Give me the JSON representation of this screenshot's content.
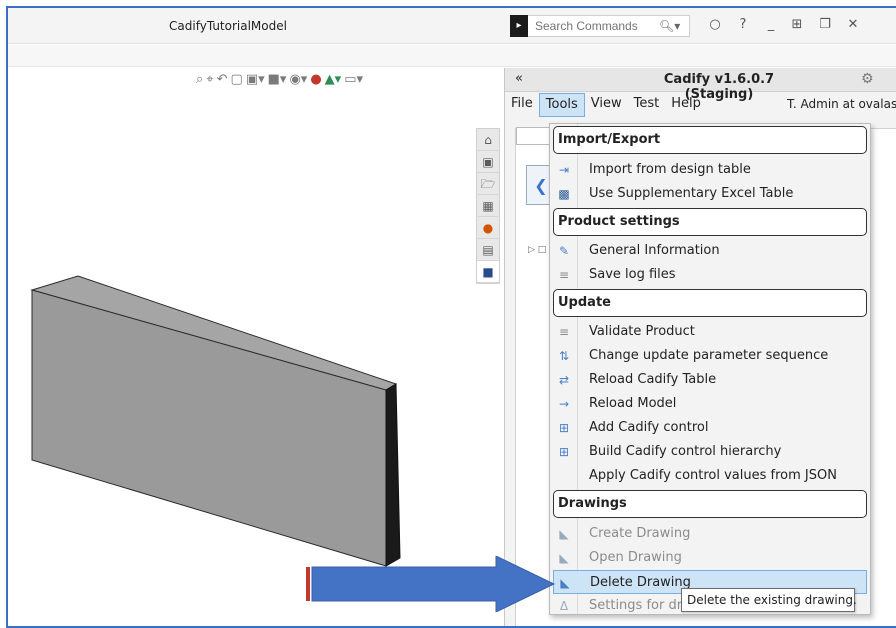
{
  "window": {
    "title": "CadifyTutorialModel",
    "search_placeholder": "Search Commands"
  },
  "panel": {
    "collapse_label": "«",
    "title": "Cadify v1.6.0.7 (Staging)",
    "user": "T. Admin at ovalas.ne",
    "menu": [
      "File",
      "Tools",
      "View",
      "Test",
      "Help"
    ]
  },
  "dropdown": {
    "sections": [
      {
        "title": "Import/Export",
        "items": [
          {
            "label": "Import from design table",
            "icon": "import-table-icon",
            "enabled": true
          },
          {
            "label": "Use Supplementary Excel Table",
            "icon": "excel-icon",
            "enabled": true
          }
        ]
      },
      {
        "title": "Product settings",
        "items": [
          {
            "label": "General Information",
            "icon": "info-edit-icon",
            "enabled": true
          },
          {
            "label": "Save log files",
            "icon": "checklist-icon",
            "enabled": true
          }
        ]
      },
      {
        "title": "Update",
        "items": [
          {
            "label": "Validate Product",
            "icon": "checklist-icon",
            "enabled": true
          },
          {
            "label": "Change update parameter sequence",
            "icon": "sort-icon",
            "enabled": true
          },
          {
            "label": "Reload Cadify Table",
            "icon": "reload-table-icon",
            "enabled": true
          },
          {
            "label": "Reload Model",
            "icon": "reload-model-icon",
            "enabled": true
          },
          {
            "label": "Add Cadify control",
            "icon": "add-control-icon",
            "enabled": true
          },
          {
            "label": "Build Cadify control hierarchy",
            "icon": "hierarchy-icon",
            "enabled": true
          },
          {
            "label": "Apply Cadify control values from JSON",
            "icon": "",
            "enabled": true
          }
        ]
      },
      {
        "title": "Drawings",
        "items": [
          {
            "label": "Create Drawing",
            "icon": "drawing-icon",
            "enabled": false
          },
          {
            "label": "Open Drawing",
            "icon": "drawing-icon",
            "enabled": false
          },
          {
            "label": "Delete Drawing",
            "icon": "drawing-icon",
            "enabled": true,
            "hover": true
          },
          {
            "label": "Settings for drawings",
            "icon": "drawing-settings-icon",
            "enabled": false
          }
        ]
      }
    ]
  },
  "tooltip": "Delete the existing drawing.",
  "colors": {
    "accent": "#3a6fc4",
    "arrow": "#4472c4",
    "arrow_tail": "#c0392b",
    "hover": "#cde4f7"
  }
}
